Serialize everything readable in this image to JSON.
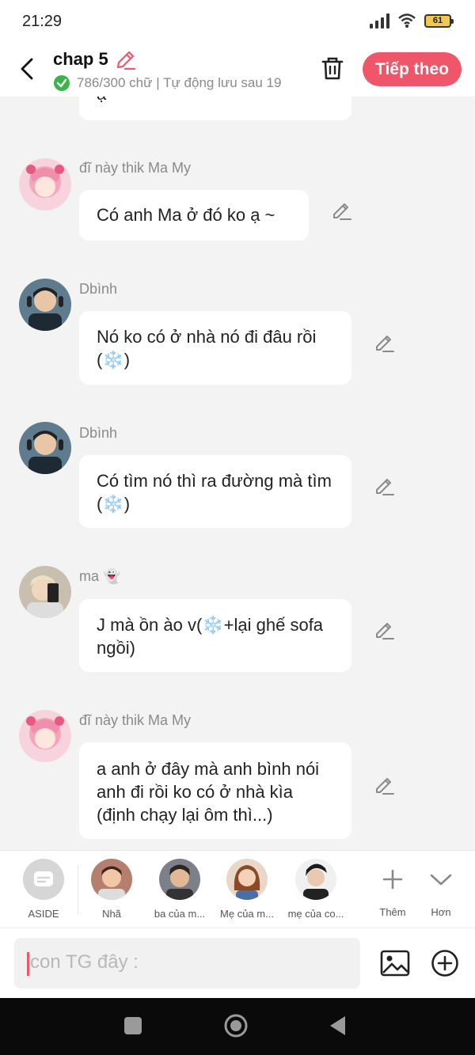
{
  "status": {
    "time": "21:29",
    "battery": "61"
  },
  "header": {
    "title": "chap 5",
    "word_count": "786/300 chữ | Tự động lưu sau 19",
    "next_label": "Tiếp theo"
  },
  "messages": [
    {
      "sender": "",
      "text": "ạ~"
    },
    {
      "sender": "đĩ này thik Ma My",
      "text": "Có anh Ma ở đó ko ạ ~"
    },
    {
      "sender": "Dbình",
      "text": "Nó ko có ở nhà nó đi đâu rồi (❄️)"
    },
    {
      "sender": "Dbình",
      "text": "Có tìm nó thì ra đường mà tìm (❄️)"
    },
    {
      "sender": "ma 👻",
      "text": "J mà ồn ào v(❄️+lại ghế sofa ngồi)"
    },
    {
      "sender": "đĩ này thik Ma My",
      "text": "a anh ở đây mà anh bình nói anh đi rồi ko có ở nhà kìa (định chạy lại ôm thì...)"
    }
  ],
  "characters": [
    {
      "name": "ASIDE"
    },
    {
      "name": "Nhã"
    },
    {
      "name": "ba của m..."
    },
    {
      "name": "Mẹ của m..."
    },
    {
      "name": "mẹ của co..."
    }
  ],
  "actions": {
    "add_label": "Thêm",
    "more_label": "Hơn"
  },
  "input": {
    "placeholder": "con TG đây :"
  },
  "colors": {
    "accent": "#f0566a",
    "check": "#3bb54a"
  }
}
